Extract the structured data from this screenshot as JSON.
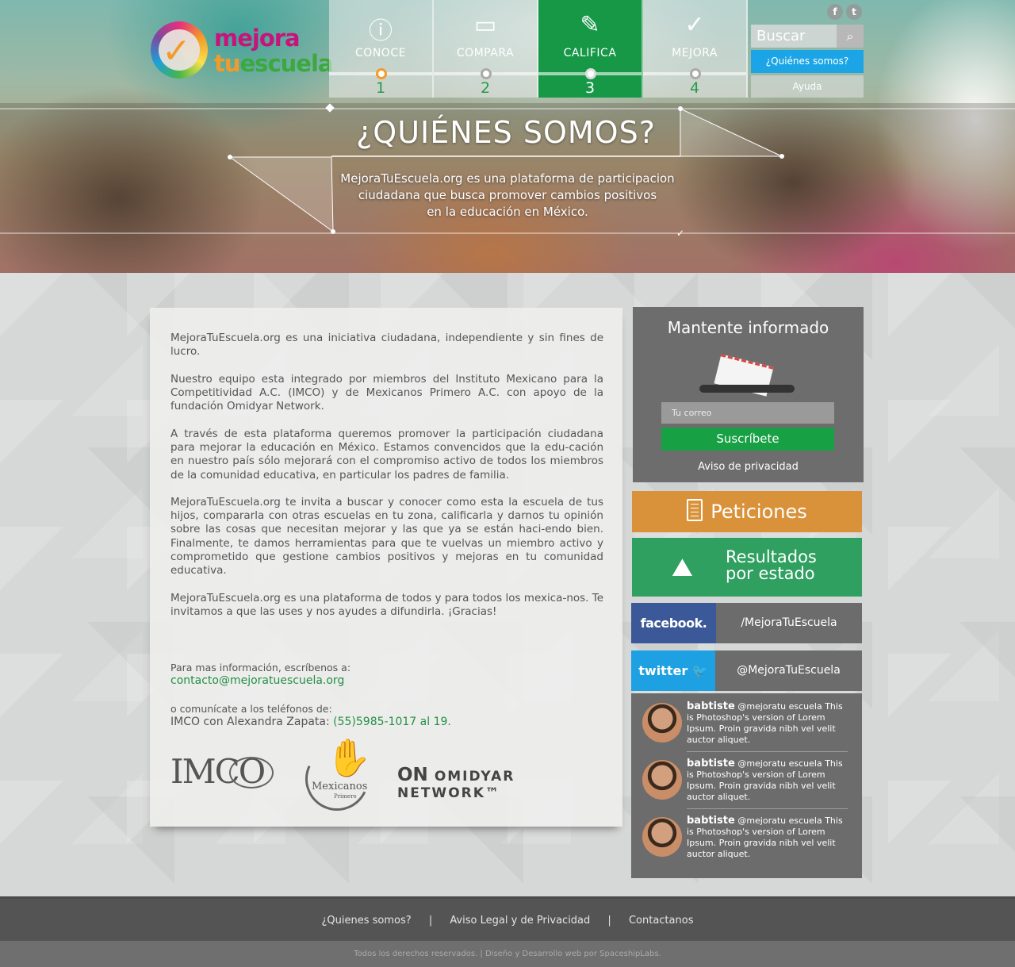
{
  "logo": {
    "line1": "mejora",
    "line2a": "tu",
    "line2b": "escuela"
  },
  "steps": [
    {
      "label": "CONOCE",
      "num": "1",
      "icon": "info-icon",
      "glyph": "ⓘ"
    },
    {
      "label": "COMPARA",
      "num": "2",
      "icon": "ruler-icon",
      "glyph": "▭"
    },
    {
      "label": "CALIFICA",
      "num": "3",
      "icon": "pencil-icon",
      "glyph": "✎"
    },
    {
      "label": "MEJORA",
      "num": "4",
      "icon": "check-circle-icon",
      "glyph": "✓"
    }
  ],
  "topnav": {
    "search_placeholder": "Buscar",
    "quienes_label": "¿Quiénes somos?",
    "ayuda_label": "Ayuda"
  },
  "hero": {
    "title": "¿QUIÉNES SOMOS?",
    "subtitle_1": "MejoraTuEscuela.org es una plataforma de participacion",
    "subtitle_2": "ciudadana que busca promover cambios positivos",
    "subtitle_3": "en la educación en México."
  },
  "content": {
    "p1": "MejoraTuEscuela.org es una iniciativa ciudadana, independiente y sin fines de lucro.",
    "p2": "Nuestro equipo esta integrado por miembros del Instituto Mexicano para la Competitividad A.C. (IMCO) y de Mexicanos Primero A.C. con apoyo de la fundación Omidyar Network.",
    "p3": "A través de esta plataforma queremos promover la participación ciudadana para mejorar la educación en México.   Estamos convencidos que la edu-cación en nuestro país sólo mejorará con el compromiso activo de todos los miembros de la comunidad educativa, en particular los padres de familia.",
    "p4": "MejoraTuEscuela.org te invita a buscar y conocer como esta la escuela de tus hijos, compararla con otras escuelas en tu zona, calificarla y darnos tu opinión sobre las cosas que necesitan mejorar y las que ya se están haci-endo bien.   Finalmente, te damos herramientas para que te vuelvas un miembro activo y comprometido que gestione cambios positivos y mejoras en tu comunidad educativa.",
    "p5": "MejoraTuEscuela.org es una plataforma de todos y para todos los mexica-nos. Te invitamos a que las uses y nos ayudes a difundirla. ¡Gracias!",
    "contact_label": "Para mas información, escríbenos a:",
    "contact_email": "contacto@mejoratuescuela.org",
    "phone_label": "o comunícate a los teléfonos de:",
    "phone_prefix": "IMCO con Alexandra Zapata: ",
    "phone_number": "(55)5985-1017 al 19."
  },
  "partners": {
    "imco": "IMCO",
    "mexicanos": "Mexicanos",
    "mexicanos_sub": "Primero",
    "omidyar_mark": "ON",
    "omidyar": "OMIDYAR NETWORK™"
  },
  "newsletter": {
    "title": "Mantente informado",
    "email_placeholder": "Tu correo",
    "subscribe_label": "Suscríbete",
    "privacy_label": "Aviso de privacidad"
  },
  "sidebar": {
    "peticiones_label": "Peticiones",
    "resultados_line1": "Resultados",
    "resultados_line2": "por estado",
    "facebook_logo": "facebook.",
    "facebook_handle": "/MejoraTuEscuela",
    "twitter_logo": "twitter",
    "twitter_handle": "@MejoraTuEscuela"
  },
  "tweets": [
    {
      "user": "babtiste",
      "text": " @mejoratu escuela This is Photoshop's version  of Lorem Ipsum. Proin gravida nibh vel velit auctor aliquet."
    },
    {
      "user": "babtiste",
      "text": " @mejoratu escuela This is Photoshop's version  of Lorem Ipsum. Proin gravida nibh vel velit auctor aliquet."
    },
    {
      "user": "babtiste",
      "text": " @mejoratu escuela This is Photoshop's version  of Lorem Ipsum. Proin gravida nibh vel velit auctor aliquet."
    }
  ],
  "footer": {
    "link1": "¿Quienes somos?",
    "link2": "Aviso Legal  y  de Privacidad",
    "link3": "Contactanos",
    "separator": "|",
    "copyright": "Todos los derechos reservados. | Diseño y Desarrollo web por SpaceshipLabs."
  },
  "colors": {
    "brand_green": "#169847",
    "accent_blue": "#1ba5e6",
    "peticiones_orange": "#d9923a",
    "facebook_blue": "#3b5998",
    "twitter_blue": "#1da1e2"
  }
}
